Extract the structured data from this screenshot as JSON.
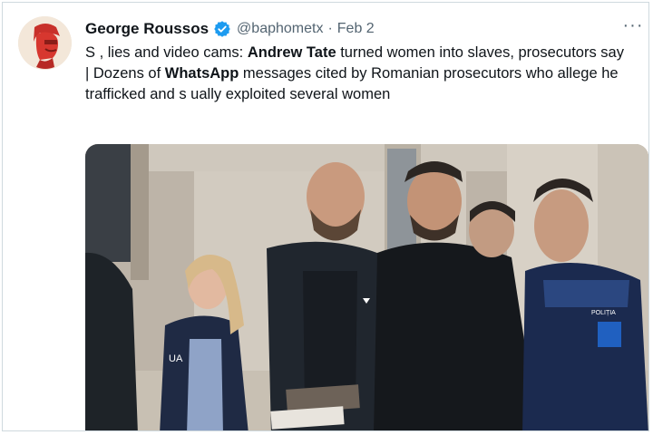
{
  "author": {
    "name": "George Roussos",
    "handle": "@baphometx",
    "separator": "·",
    "date": "Feb 2",
    "verified": true,
    "verified_color": "#1d9bf0"
  },
  "menu": {
    "more_label": "···"
  },
  "tweet": {
    "line1": "S  , lies and video cams: ",
    "bold1": "Andrew Tate",
    "line2": " turned women into slaves, prosecutors say | Dozens of ",
    "bold2": "WhatsApp",
    "line3": " messages cited by Romanian prosecutors who allege he trafficked and s     ually exploited several women"
  },
  "media": {
    "logo_text": "UA",
    "badge_text": "POLIȚIA"
  },
  "icons": {
    "avatar": "avatar-portrait-icon",
    "verified": "verified-badge-icon",
    "more": "more-options-icon"
  },
  "colors": {
    "text": "#0f1419",
    "secondary": "#536471",
    "accent": "#1d9bf0"
  }
}
